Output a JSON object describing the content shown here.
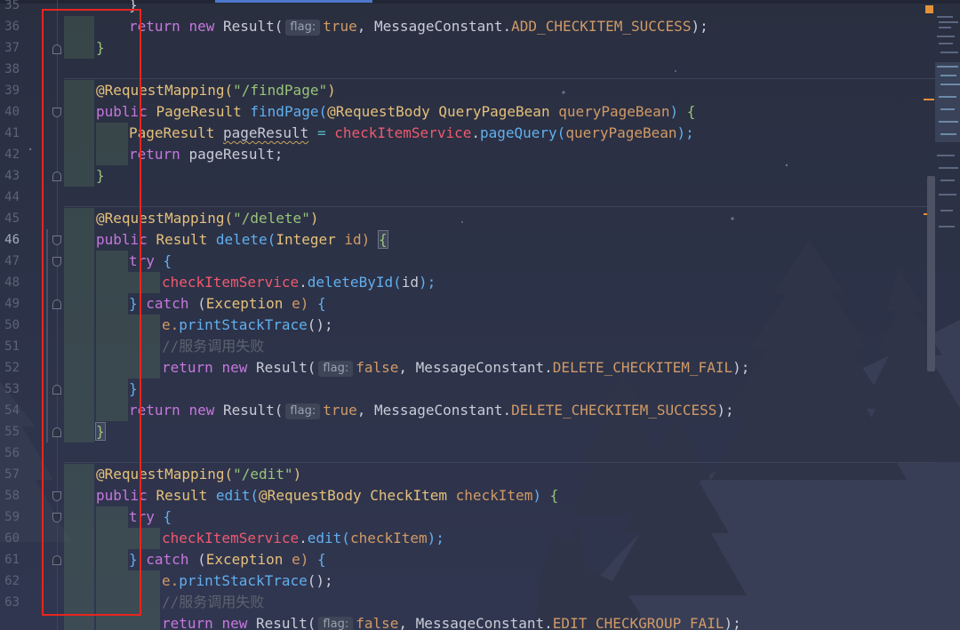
{
  "editor": {
    "colors": {
      "selection_box": "#e8251e",
      "keyword": "#c678dd",
      "string": "#98c379",
      "function": "#61afef"
    },
    "fold_icons": "fold-marker-icon",
    "lines": [
      {
        "num": "35",
        "active": false
      },
      {
        "num": "36",
        "active": false
      },
      {
        "num": "37",
        "active": false
      },
      {
        "num": "38",
        "active": false
      },
      {
        "num": "39",
        "active": false
      },
      {
        "num": "40",
        "active": false
      },
      {
        "num": "41",
        "active": false
      },
      {
        "num": "42",
        "active": false
      },
      {
        "num": "43",
        "active": false
      },
      {
        "num": "44",
        "active": false
      },
      {
        "num": "45",
        "active": false
      },
      {
        "num": "46",
        "active": true
      },
      {
        "num": "47",
        "active": false
      },
      {
        "num": "48",
        "active": false
      },
      {
        "num": "49",
        "active": false
      },
      {
        "num": "50",
        "active": false
      },
      {
        "num": "51",
        "active": false
      },
      {
        "num": "52",
        "active": false
      },
      {
        "num": "53",
        "active": false
      },
      {
        "num": "54",
        "active": false
      },
      {
        "num": "55",
        "active": false
      },
      {
        "num": "56",
        "active": false
      },
      {
        "num": "57",
        "active": false
      },
      {
        "num": "58",
        "active": false
      },
      {
        "num": "59",
        "active": false
      },
      {
        "num": "60",
        "active": false
      },
      {
        "num": "61",
        "active": false
      },
      {
        "num": "62",
        "active": false
      },
      {
        "num": "63",
        "active": false
      }
    ]
  },
  "code": {
    "l35_brace": "}",
    "l36": {
      "kw_return": "return",
      "kw_new": "new",
      "type": "Result(",
      "hint": "flag:",
      "bool": "true",
      "sep": ",",
      "const_class": "MessageConstant.",
      "const": "ADD_CHECKITEM_SUCCESS",
      "end": ");"
    },
    "l37_brace": "}",
    "l39": {
      "annotation": "@RequestMapping(",
      "string": "\"/findPage\"",
      "end": ")"
    },
    "l40": {
      "kw_public": "public",
      "type": "PageResult",
      "fn": "findPage(",
      "annotation": "@RequestBody",
      "param_type": "QueryPageBean",
      "param": "queryPageBean",
      "end": ")",
      "brace": "{"
    },
    "l41": {
      "type": "PageResult",
      "var": "pageResult",
      "eq": "=",
      "field": "checkItemService",
      "dot": ".",
      "fn": "pageQuery(",
      "arg": "queryPageBean",
      "end": ");"
    },
    "l42": {
      "kw_return": "return",
      "var": "pageResult;"
    },
    "l43_brace": "}",
    "l45": {
      "annotation": "@RequestMapping(",
      "string": "\"/delete\"",
      "end": ")"
    },
    "l46": {
      "kw_public": "public",
      "type": "Result",
      "fn": "delete(",
      "param_type": "Integer",
      "param": "id)",
      "brace": "{"
    },
    "l47": {
      "kw_try": "try",
      "brace": "{"
    },
    "l48": {
      "field": "checkItemService",
      "dot": ".",
      "fn": "deleteById(",
      "arg": "id",
      "end": ");"
    },
    "l49": {
      "brace": "}",
      "kw_catch": "catch",
      "paren": "(",
      "type": "Exception",
      "var": "e)",
      "brace2": "{"
    },
    "l50": {
      "var": "e.",
      "fn": "printStackTrace",
      "end": "();"
    },
    "l51_comment": "//服务调用失败",
    "l52": {
      "kw_return": "return",
      "kw_new": "new",
      "type": "Result(",
      "hint": "flag:",
      "bool": "false",
      "sep": ",",
      "const_class": "MessageConstant.",
      "const": "DELETE_CHECKITEM_FAIL",
      "end": ");"
    },
    "l53_brace": "}",
    "l54": {
      "kw_return": "return",
      "kw_new": "new",
      "type": "Result(",
      "hint": "flag:",
      "bool": "true",
      "sep": ",",
      "const_class": "MessageConstant.",
      "const": "DELETE_CHECKITEM_SUCCESS",
      "end": ");"
    },
    "l55_brace": "}",
    "l57": {
      "annotation": "@RequestMapping(",
      "string": "\"/edit\"",
      "end": ")"
    },
    "l58": {
      "kw_public": "public",
      "type": "Result",
      "fn": "edit(",
      "annotation": "@RequestBody",
      "param_type": "CheckItem",
      "param": "checkItem",
      "end": ")",
      "brace": "{"
    },
    "l59": {
      "kw_try": "try",
      "brace": "{"
    },
    "l60": {
      "field": "checkItemService",
      "dot": ".",
      "fn": "edit(",
      "arg": "checkItem",
      "end": ");"
    },
    "l61": {
      "brace": "}",
      "kw_catch": "catch",
      "paren": "(",
      "type": "Exception",
      "var": "e)",
      "brace2": "{"
    },
    "l62": {
      "var": "e.",
      "fn": "printStackTrace",
      "end": "();"
    },
    "l63_comment": "//服务调用失败",
    "l64": {
      "kw_return": "return",
      "kw_new": "new",
      "type": "Result(",
      "hint": "flag:",
      "bool": "false",
      "sep": ",",
      "const_class": "MessageConstant.",
      "const": "EDIT_CHECKGROUP_FAIL",
      "end": ");"
    }
  }
}
